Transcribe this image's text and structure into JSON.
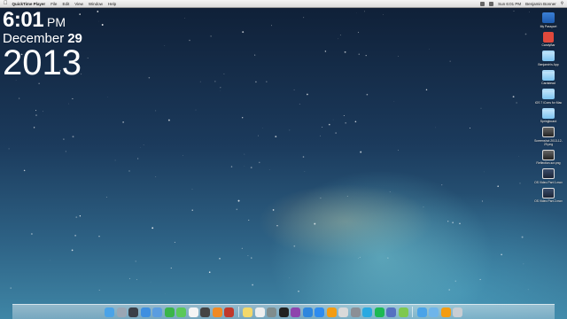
{
  "menubar": {
    "app_name": "QuickTime Player",
    "menus": [
      "File",
      "Edit",
      "View",
      "Window",
      "Help"
    ],
    "clock": "Sun 6:01 PM",
    "user": "Benjamin Bonner"
  },
  "widget": {
    "time": "6:01",
    "ampm": "PM",
    "month": "December",
    "day": "29",
    "year": "2013"
  },
  "desktop_icons": [
    {
      "label": "My Passport",
      "icon": "passport-drive-icon"
    },
    {
      "label": "CandyBar",
      "icon": "candybar-icon"
    },
    {
      "label": "Benjamin's App",
      "icon": "folder-icon"
    },
    {
      "label": "Cardstead",
      "icon": "folder-icon"
    },
    {
      "label": "iOS 7 iCons for Mac",
      "icon": "folder-icon"
    },
    {
      "label": "Springboard",
      "icon": "folder-icon"
    },
    {
      "label": "Screenshot 2013-12-29.png",
      "icon": "image-file-icon"
    },
    {
      "label": "Reflection-scr.png",
      "icon": "image-file-icon"
    },
    {
      "label": "OS Video Part 1.mov",
      "icon": "video-file-icon"
    },
    {
      "label": "OS Video Part 2.mov",
      "icon": "video-file-icon"
    }
  ],
  "dock": [
    {
      "name": "finder",
      "color": "#4aa3e8"
    },
    {
      "name": "launchpad",
      "color": "#9aa6b4"
    },
    {
      "name": "mission-control",
      "color": "#3a3f48"
    },
    {
      "name": "safari",
      "color": "#3f8fe0"
    },
    {
      "name": "mail",
      "color": "#5b9de0"
    },
    {
      "name": "facetime",
      "color": "#3ab54a"
    },
    {
      "name": "messages",
      "color": "#5ac85a"
    },
    {
      "name": "calendar",
      "color": "#f4f4f4"
    },
    {
      "name": "camera",
      "color": "#444444"
    },
    {
      "name": "iphoto",
      "color": "#f08a24"
    },
    {
      "name": "photo-booth",
      "color": "#c0392b"
    },
    {
      "name": "separator"
    },
    {
      "name": "notes",
      "color": "#f3d86a"
    },
    {
      "name": "textedit",
      "color": "#eeeeee"
    },
    {
      "name": "preview",
      "color": "#7f8c8d"
    },
    {
      "name": "dvd-player",
      "color": "#222222"
    },
    {
      "name": "imovie",
      "color": "#8e44ad"
    },
    {
      "name": "itunes",
      "color": "#2e86de"
    },
    {
      "name": "app-store",
      "color": "#2e8bef"
    },
    {
      "name": "ibooks",
      "color": "#f39c12"
    },
    {
      "name": "game-center",
      "color": "#d9d9d9"
    },
    {
      "name": "settings",
      "color": "#8b8f96"
    },
    {
      "name": "twitter",
      "color": "#29a9e1"
    },
    {
      "name": "spotify",
      "color": "#1db954"
    },
    {
      "name": "xcode",
      "color": "#5571c1"
    },
    {
      "name": "maps",
      "color": "#7ec850"
    },
    {
      "name": "separator"
    },
    {
      "name": "downloads",
      "color": "#4aa3e8"
    },
    {
      "name": "documents",
      "color": "#6fb5ea"
    },
    {
      "name": "music",
      "color": "#f39c12"
    },
    {
      "name": "trash",
      "color": "#c8cdd3"
    }
  ]
}
